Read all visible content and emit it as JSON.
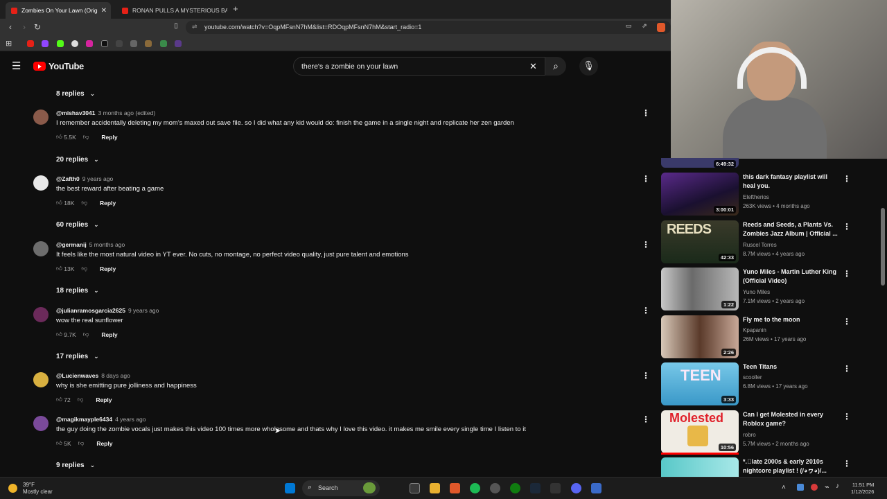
{
  "browser": {
    "tabs": [
      {
        "title": "Zombies On Your Lawn (Orig",
        "active": true
      },
      {
        "title": "RONAN PULLS A MYSTERIOUS BALL",
        "active": false
      }
    ],
    "new_tab": "+",
    "url": "youtube.com/watch?v=OqpMFsnN7hM&list=RDOqpMFsnN7hM&start_radio=1"
  },
  "youtube": {
    "logo_text": "YouTube",
    "search_query": "there's a zombie on your lawn"
  },
  "comments": {
    "top_replies": "8 replies",
    "items": [
      {
        "handle": "@mishav3041",
        "time": "3 months ago (edited)",
        "text": "I remember accidentally deleting my mom's maxed out save file. so I did what any kid would do: finish the game in a single night and replicate her zen garden",
        "likes": "5.5K",
        "reply": "Reply",
        "replies": "20 replies",
        "avatar_color": "#8a5a4a"
      },
      {
        "handle": "@Zafth0",
        "time": "9 years ago",
        "text": "the best reward after beating a game",
        "likes": "18K",
        "reply": "Reply",
        "replies": "60 replies",
        "avatar_color": "#e8e8e8"
      },
      {
        "handle": "@germanij",
        "time": "5 months ago",
        "text": "It feels like the most natural video in YT ever. No cuts, no montage, no perfect video quality, just pure talent and emotions",
        "likes": "13K",
        "reply": "Reply",
        "replies": "18 replies",
        "avatar_color": "#6d6d6d"
      },
      {
        "handle": "@julianramosgarcia2625",
        "time": "9 years ago",
        "text": "wow the real sunflower",
        "likes": "9.7K",
        "reply": "Reply",
        "replies": "17 replies",
        "avatar_color": "#6b2a5a"
      },
      {
        "handle": "@Lucienwaves",
        "time": "8 days ago",
        "text": "why is she emitting pure jolliness and happiness",
        "likes": "72",
        "reply": "Reply",
        "replies": "",
        "avatar_color": "#d8b040"
      },
      {
        "handle": "@magikmayple6434",
        "time": "4 years ago",
        "text": "the guy doing the zombie vocals just makes this video 100 times more wholesome and thats why I love this video. it makes me smile every single time I listen to it",
        "likes": "5K",
        "reply": "Reply",
        "replies": "9 replies",
        "avatar_color": "#7a4a9a"
      }
    ]
  },
  "sidebar_videos": [
    {
      "title": "",
      "channel": "",
      "meta": "",
      "duration": "6:49:32",
      "thumb": "#3a3a6a"
    },
    {
      "title": "this dark fantasy playlist will heal you.",
      "channel": "Eleftherios",
      "meta": "263K views • 4 months ago",
      "duration": "3:00:01",
      "thumb": "#2a1a4a"
    },
    {
      "title": "Reeds and Seeds, a Plants Vs. Zombies Jazz Album | Official ...",
      "channel": "Ruscel Torres",
      "meta": "8.7M views • 4 years ago",
      "duration": "42:33",
      "thumb": "#4a5a2a"
    },
    {
      "title": "Yuno Miles - Martin Luther King (Official Video)",
      "channel": "Yuno Miles",
      "meta": "7.1M views • 2 years ago",
      "duration": "1:22",
      "thumb": "#8a8a8a"
    },
    {
      "title": "Fly me to the moon",
      "channel": "Kpapanin",
      "meta": "26M views • 17 years ago",
      "duration": "2:26",
      "thumb": "#6a4a3a"
    },
    {
      "title": "Teen Titans",
      "channel": "scooller",
      "meta": "6.8M views • 17 years ago",
      "duration": "3:33",
      "thumb": "#5ab0d8"
    },
    {
      "title": "Can I get Molested in every Roblox game?",
      "channel": "robro",
      "meta": "5.7M views • 2 months ago",
      "duration": "10:56",
      "thumb": "#e8e0d0"
    },
    {
      "title": "*.゚late 2000s & early 2010s nightcore playlist ! (/◕ヮ◕)/...",
      "channel": "",
      "meta": "",
      "duration": "",
      "thumb": "#5ac8c8"
    }
  ],
  "sidebar_badges": {
    "reeds": "REEDS",
    "molested": "Molested",
    "teen": "TEEN"
  },
  "taskbar": {
    "weather_temp": "39°F",
    "weather_desc": "Mostly clear",
    "search_label": "Search",
    "time": "11:51 PM",
    "date": "1/12/2026"
  }
}
